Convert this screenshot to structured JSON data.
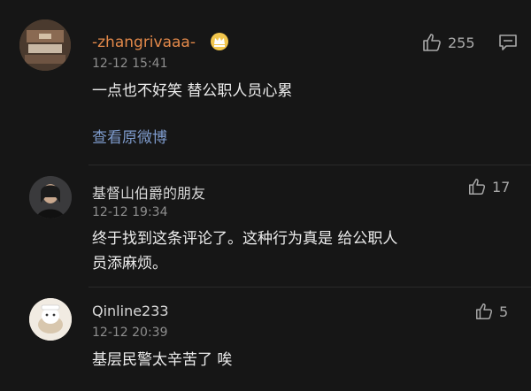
{
  "comments": [
    {
      "username": "-zhangrivaaa-",
      "time": "12-12 15:41",
      "text": "一点也不好笑 替公职人员心累",
      "likes": "255",
      "view_original": "查看原微博",
      "username_color": "#e3894a"
    },
    {
      "username": "基督山伯爵的朋友",
      "time": "12-12 19:34",
      "text": "终于找到这条评论了。这种行为真是 给公职人员添麻烦。",
      "likes": "17"
    },
    {
      "username": "Qinline233",
      "time": "12-12 20:39",
      "text": "基层民警太辛苦了 唉",
      "likes": "5"
    }
  ],
  "icons": {
    "like": "thumbs-up-icon",
    "reply": "comment-bubble-icon",
    "vip": "crown-badge-icon"
  },
  "colors": {
    "background": "#161616",
    "link": "#7e9bcc",
    "muted": "#8e8e8e"
  }
}
